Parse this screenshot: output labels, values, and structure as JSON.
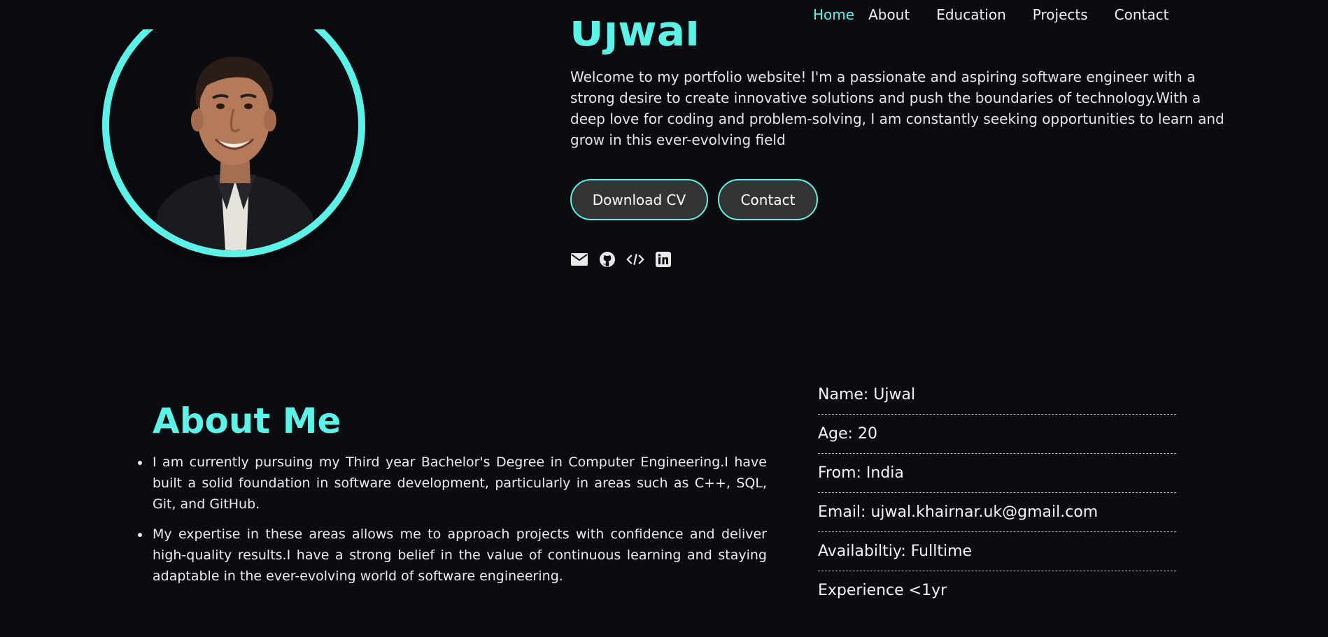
{
  "nav": {
    "logo_icon": "lightning-bolt-icon",
    "items": [
      "Home",
      "About",
      "Education",
      "Projects",
      "Contact"
    ],
    "active": "Home"
  },
  "hero": {
    "name": "Ujwal",
    "intro": "Welcome to my portfolio website! I'm a passionate and aspiring software engineer with a strong desire to create innovative solutions and push the boundaries of technology.With a deep love for coding and problem-solving, I am constantly seeking opportunities to learn and grow in this ever-evolving field",
    "buttons": {
      "download": "Download CV",
      "contact": "Contact"
    },
    "socials": [
      "envelope-icon",
      "github-icon",
      "code-icon",
      "linkedin-icon"
    ]
  },
  "about": {
    "title": "About Me",
    "points": [
      "I am currently pursuing my Third year Bachelor's Degree in Computer Engineering.I have built a solid foundation in software development, particularly in areas such as C++, SQL, Git, and GitHub.",
      "My expertise in these areas allows me to approach projects with confidence and deliver high-quality results.I have a strong belief in the value of continuous learning and staying adaptable in the ever-evolving world of software engineering."
    ],
    "info": [
      "Name: Ujwal",
      "Age: 20",
      "From: India",
      "Email: ujwal.khairnar.uk@gmail.com",
      "Availabiltiy: Fulltime",
      "Experience <1yr"
    ]
  },
  "colors": {
    "accent": "#5cf2e8",
    "background": "#0a0c10",
    "button_bg": "#343434"
  }
}
